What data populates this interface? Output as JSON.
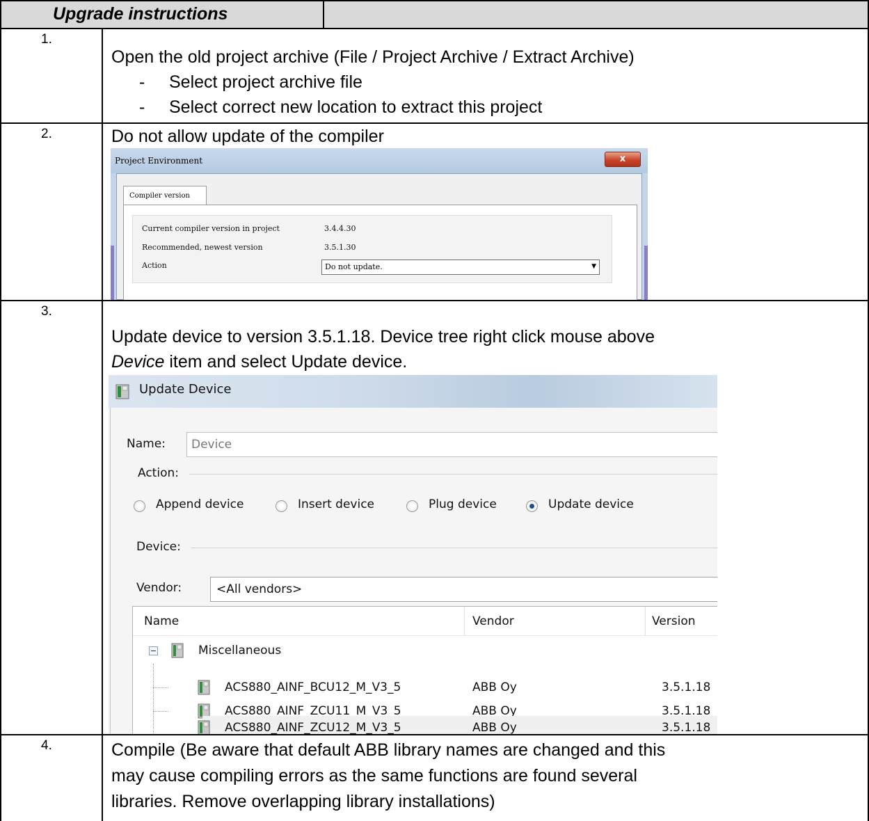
{
  "header": {
    "title": "Upgrade instructions"
  },
  "steps": [
    {
      "number": "1.",
      "lines": [
        "Open the old project archive (File / Project Archive / Extract Archive)"
      ],
      "bullets": [
        "Select project archive file",
        "Select correct new location to extract this project"
      ]
    },
    {
      "number": "2.",
      "lines": [
        "Do not allow update of the compiler"
      ]
    },
    {
      "number": "3.",
      "line1": "Update device to version 3.5.1.18. Device tree right click mouse above",
      "line2_italic": "Device",
      "line2_rest": " item and select Update device."
    },
    {
      "number": "4.",
      "lines": [
        "Compile (Be aware that default ABB library names are changed and this",
        "may cause compiling errors as the same functions are found several",
        "libraries. Remove overlapping library installations)"
      ]
    }
  ],
  "bullet_marker": "-",
  "project_environment": {
    "title": "Project Environment",
    "close_glyph": "x",
    "tab": "Compiler version",
    "rows": [
      {
        "label": "Current compiler version in project",
        "value": "3.4.4.30"
      },
      {
        "label": "Recommended, newest version",
        "value": "3.5.1.30"
      }
    ],
    "action_label": "Action",
    "action_value": "Do not update.",
    "dropdown_glyph": "▼"
  },
  "update_device": {
    "title": "Update Device",
    "name_label": "Name:",
    "name_value": "Device",
    "action_label": "Action:",
    "radios": [
      {
        "label": "Append device",
        "selected": false
      },
      {
        "label": "Insert device",
        "selected": false
      },
      {
        "label": "Plug device",
        "selected": false
      },
      {
        "label": "Update device",
        "selected": true
      }
    ],
    "device_label": "Device:",
    "vendor_label": "Vendor:",
    "vendor_value": "<All vendors>",
    "columns": [
      "Name",
      "Vendor",
      "Version"
    ],
    "group": "Miscellaneous",
    "devices": [
      {
        "name": "ACS880_AINF_BCU12_M_V3_5",
        "vendor": "ABB Oy",
        "version": "3.5.1.18"
      },
      {
        "name": "ACS880_AINF_ZCU11_M_V3_5",
        "vendor": "ABB Oy",
        "version": "3.5.1.18"
      },
      {
        "name": "ACS880_AINF_ZCU12_M_V3_5",
        "vendor": "ABB Oy",
        "version": "3.5.1.18"
      }
    ]
  }
}
